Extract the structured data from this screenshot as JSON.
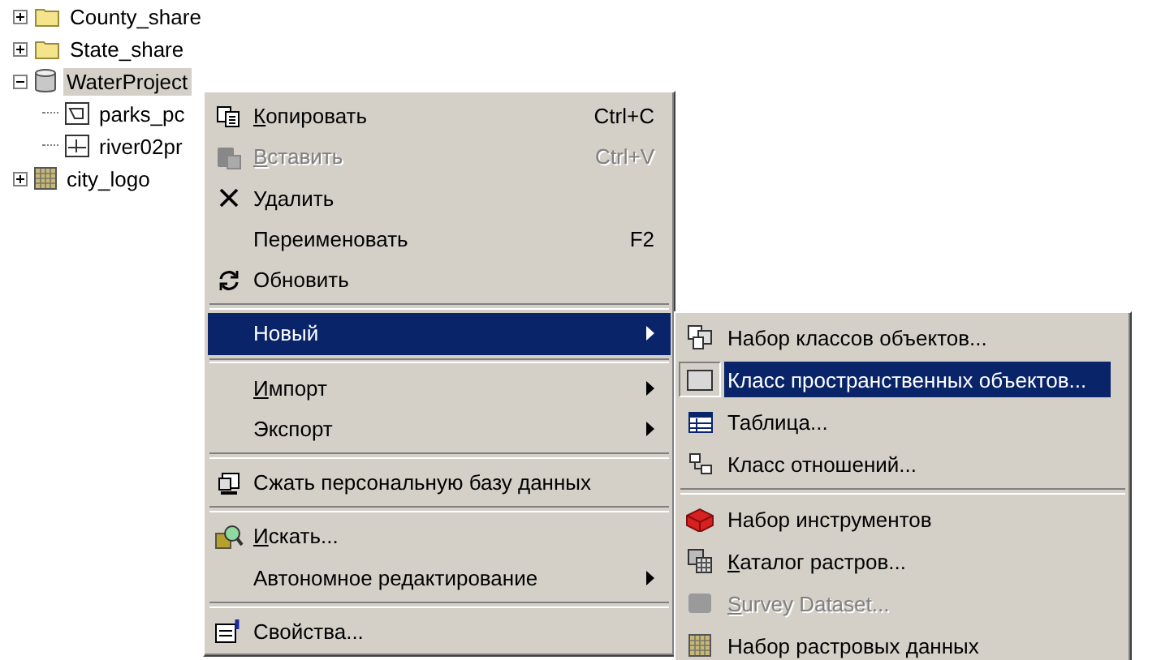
{
  "tree": [
    {
      "label": "County_share",
      "kind": "folder",
      "expanded": false,
      "selected": false
    },
    {
      "label": "State_share",
      "kind": "folder",
      "expanded": false,
      "selected": false
    },
    {
      "label": "WaterProject",
      "kind": "database",
      "expanded": true,
      "selected": true,
      "children": [
        {
          "label": "parks_pc",
          "kind": "polygon",
          "selected": false
        },
        {
          "label": "river02pr",
          "kind": "line",
          "selected": false
        }
      ]
    },
    {
      "label": "city_logo",
      "kind": "raster",
      "expanded": false,
      "selected": false
    }
  ],
  "menu": {
    "items": [
      {
        "kind": "item",
        "label": "Копировать",
        "shortcut": "Ctrl+C",
        "accel_first": true,
        "disabled": false,
        "selected": false,
        "submenu": false
      },
      {
        "kind": "item",
        "label": "Вставить",
        "shortcut": "Ctrl+V",
        "accel_first": true,
        "disabled": true,
        "selected": false,
        "submenu": false
      },
      {
        "kind": "item",
        "label": "Удалить",
        "accel_first": false,
        "disabled": false,
        "selected": false,
        "submenu": false
      },
      {
        "kind": "item",
        "label": "Переименовать",
        "shortcut": "F2",
        "accel_first": false,
        "disabled": false,
        "selected": false,
        "submenu": false
      },
      {
        "kind": "item",
        "label": "Обновить",
        "accel_first": false,
        "disabled": false,
        "selected": false,
        "submenu": false
      },
      {
        "kind": "separator"
      },
      {
        "kind": "item",
        "label": "Новый",
        "accel_first": false,
        "disabled": false,
        "selected": true,
        "submenu": true
      },
      {
        "kind": "separator"
      },
      {
        "kind": "item",
        "label": "Импорт",
        "accel_first": true,
        "disabled": false,
        "selected": false,
        "submenu": true
      },
      {
        "kind": "item",
        "label": "Экспорт",
        "accel_first": false,
        "disabled": false,
        "selected": false,
        "submenu": true
      },
      {
        "kind": "separator"
      },
      {
        "kind": "item",
        "label": "Сжать персональную базу данных",
        "accel_first": false,
        "disabled": false,
        "selected": false,
        "submenu": false
      },
      {
        "kind": "separator"
      },
      {
        "kind": "item",
        "label": "Искать...",
        "accel_first": true,
        "disabled": false,
        "selected": false,
        "submenu": false
      },
      {
        "kind": "item",
        "label": "Автономное редактирование",
        "accel_first": false,
        "disabled": false,
        "selected": false,
        "submenu": true
      },
      {
        "kind": "separator"
      },
      {
        "kind": "item",
        "label": "Свойства...",
        "accel_first": false,
        "disabled": false,
        "selected": false,
        "submenu": false
      }
    ]
  },
  "submenu": {
    "items": [
      {
        "kind": "item",
        "label": "Набор классов объектов...",
        "accel_first": false,
        "disabled": false,
        "selected": false
      },
      {
        "kind": "item",
        "label": "Класс пространственных объектов...",
        "accel_first": false,
        "disabled": false,
        "selected": true
      },
      {
        "kind": "item",
        "label": "Таблица...",
        "accel_first": false,
        "disabled": false,
        "selected": false
      },
      {
        "kind": "item",
        "label": "Класс отношений...",
        "accel_first": false,
        "disabled": false,
        "selected": false
      },
      {
        "kind": "separator"
      },
      {
        "kind": "item",
        "label": "Набор инструментов",
        "accel_first": false,
        "disabled": false,
        "selected": false
      },
      {
        "kind": "item",
        "label": "Каталог растров...",
        "accel_first": true,
        "disabled": false,
        "selected": false
      },
      {
        "kind": "item",
        "label": "Survey Dataset...",
        "accel_first": true,
        "disabled": true,
        "selected": false
      },
      {
        "kind": "item",
        "label": "Набор растровых данных",
        "accel_first": false,
        "disabled": false,
        "selected": false
      }
    ]
  }
}
